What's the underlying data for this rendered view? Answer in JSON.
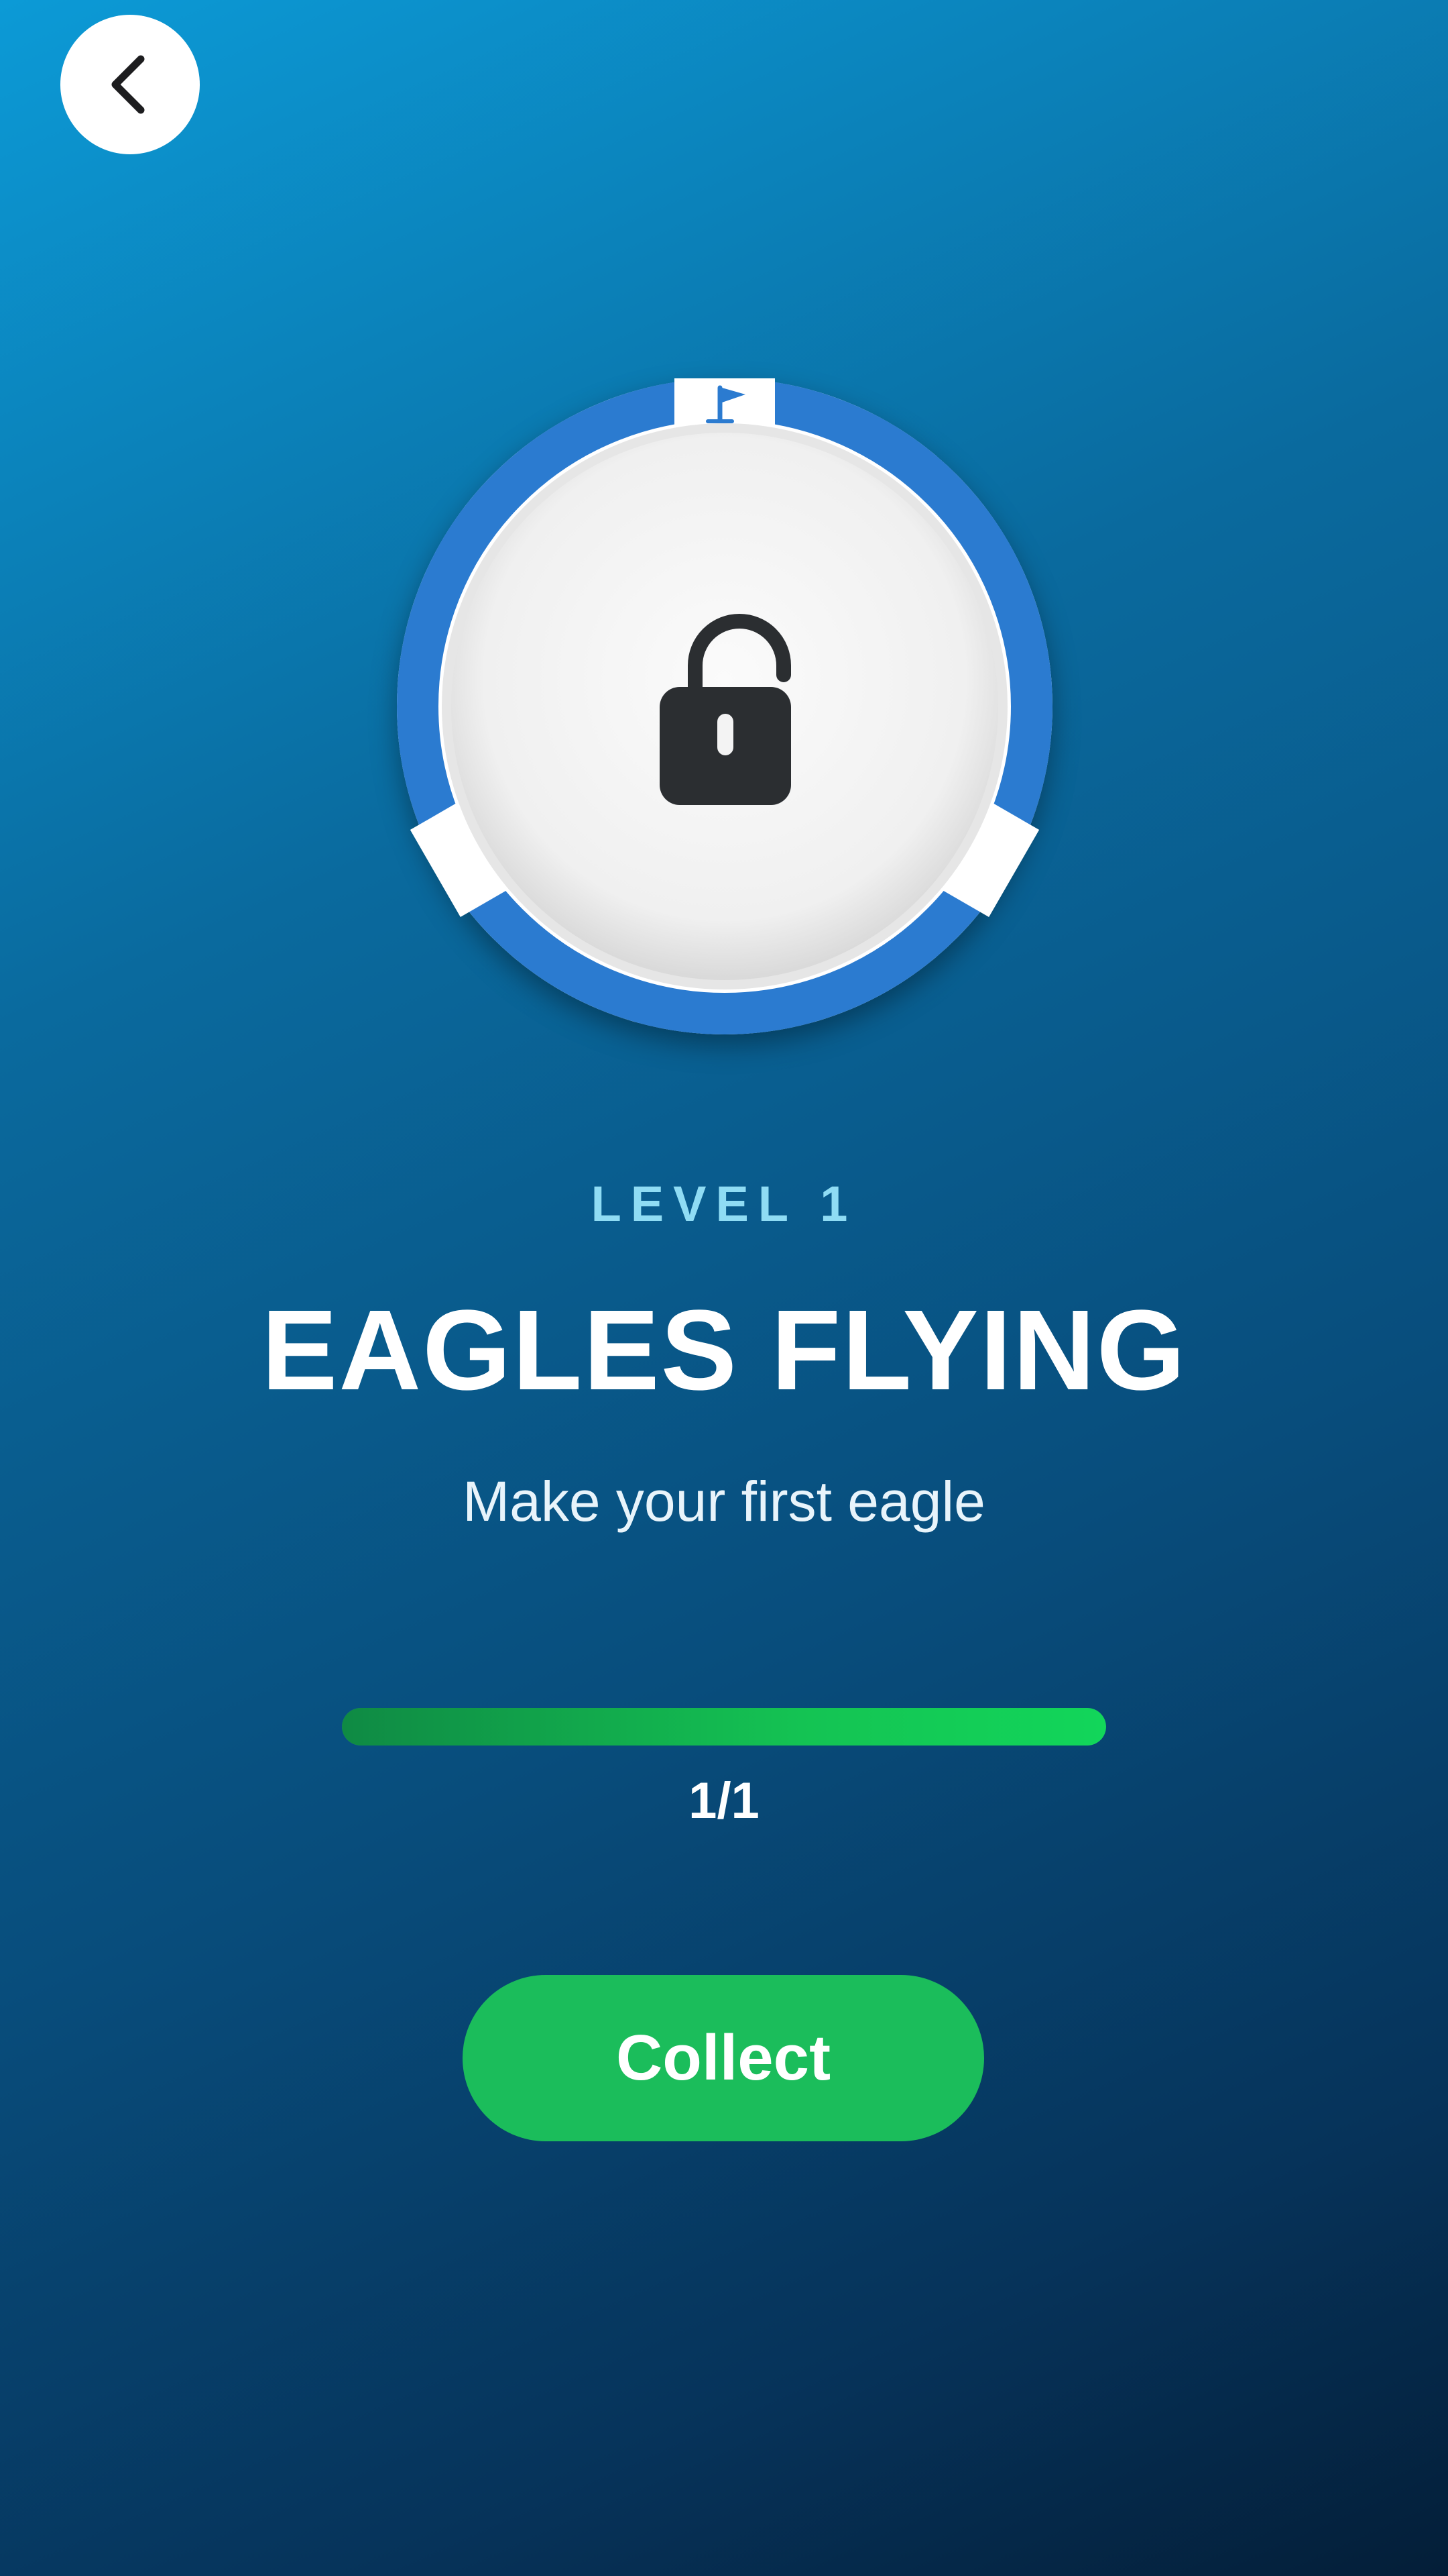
{
  "header": {
    "back_button_icon": "chevron-left-icon"
  },
  "badge": {
    "center_icon": "unlocked-padlock-icon",
    "top_icon": "golf-flag-icon",
    "ring_color": "#2b7bd0",
    "face_color": "#f3f3f3",
    "icon_color": "#2b2e31"
  },
  "achievement": {
    "level": "LEVEL 1",
    "title": "EAGLES FLYING",
    "description": "Make your first eagle"
  },
  "progress": {
    "current": 1,
    "total": 1,
    "fraction": 1.0,
    "text": "1/1"
  },
  "actions": {
    "collect_label": "Collect"
  },
  "colors": {
    "accent_green": "#1bbd5b",
    "level_text": "#8fdcf4"
  }
}
